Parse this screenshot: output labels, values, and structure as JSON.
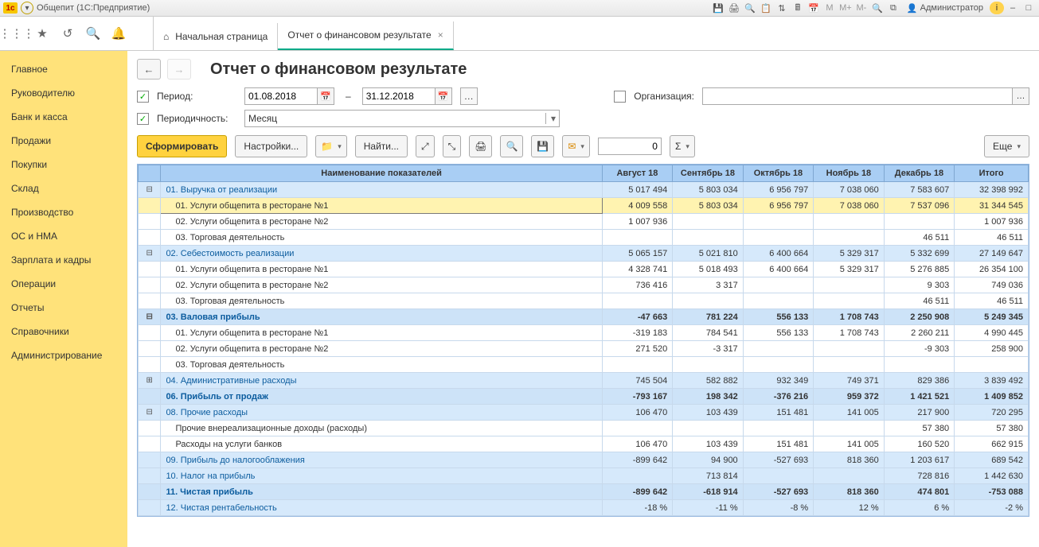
{
  "window": {
    "title": "Общепит  (1С:Предприятие)",
    "user": "Администратор"
  },
  "tabs": {
    "home": "Начальная страница",
    "report": "Отчет о финансовом результате"
  },
  "sidebar": {
    "items": [
      "Главное",
      "Руководителю",
      "Банк и касса",
      "Продажи",
      "Покупки",
      "Склад",
      "Производство",
      "ОС и НМА",
      "Зарплата и кадры",
      "Операции",
      "Отчеты",
      "Справочники",
      "Администрирование"
    ]
  },
  "page": {
    "title": "Отчет о финансовом результате"
  },
  "filters": {
    "period_label": "Период:",
    "date_from": "01.08.2018",
    "date_to": "31.12.2018",
    "org_label": "Организация:",
    "org_value": "",
    "periodicity_label": "Периодичность:",
    "periodicity_value": "Месяц"
  },
  "toolbar": {
    "generate": "Сформировать",
    "settings": "Настройки...",
    "find": "Найти...",
    "number_value": "0",
    "more": "Еще"
  },
  "table": {
    "headers": {
      "name": "Наименование показателей",
      "months": [
        "Август 18",
        "Сентябрь 18",
        "Октябрь 18",
        "Ноябрь 18",
        "Декабрь 18"
      ],
      "total": "Итого"
    },
    "rows": [
      {
        "lvl": 0,
        "tg": "-",
        "link": true,
        "name": "01. Выручка от реализации",
        "v": [
          "5 017 494",
          "5 803 034",
          "6 956 797",
          "7 038 060",
          "7 583 607",
          "32 398 992"
        ]
      },
      {
        "lvl": 1,
        "hl": true,
        "name": "01. Услуги общепита в ресторане №1",
        "v": [
          "4 009 558",
          "5 803 034",
          "6 956 797",
          "7 038 060",
          "7 537 096",
          "31 344 545"
        ]
      },
      {
        "lvl": 1,
        "name": "02. Услуги общепита в ресторане №2",
        "v": [
          "1 007 936",
          "",
          "",
          "",
          "",
          "1 007 936"
        ]
      },
      {
        "lvl": 1,
        "name": "03. Торговая деятельность",
        "v": [
          "",
          "",
          "",
          "",
          "46 511",
          "46 511"
        ]
      },
      {
        "lvl": 0,
        "tg": "-",
        "link": true,
        "name": "02. Себестоимость реализации",
        "v": [
          "5 065 157",
          "5 021 810",
          "6 400 664",
          "5 329 317",
          "5 332 699",
          "27 149 647"
        ]
      },
      {
        "lvl": 1,
        "name": "01. Услуги общепита в ресторане №1",
        "v": [
          "4 328 741",
          "5 018 493",
          "6 400 664",
          "5 329 317",
          "5 276 885",
          "26 354 100"
        ]
      },
      {
        "lvl": 1,
        "name": "02. Услуги общепита в ресторане №2",
        "v": [
          "736 416",
          "3 317",
          "",
          "",
          "9 303",
          "749 036"
        ]
      },
      {
        "lvl": 1,
        "name": "03. Торговая деятельность",
        "v": [
          "",
          "",
          "",
          "",
          "46 511",
          "46 511"
        ]
      },
      {
        "lvl": 0,
        "tg": "-",
        "bold": true,
        "link": true,
        "name": "03. Валовая прибыль",
        "v": [
          "-47 663",
          "781 224",
          "556 133",
          "1 708 743",
          "2 250 908",
          "5 249 345"
        ]
      },
      {
        "lvl": 1,
        "name": "01. Услуги общепита в ресторане №1",
        "v": [
          "-319 183",
          "784 541",
          "556 133",
          "1 708 743",
          "2 260 211",
          "4 990 445"
        ]
      },
      {
        "lvl": 1,
        "name": "02. Услуги общепита в ресторане №2",
        "v": [
          "271 520",
          "-3 317",
          "",
          "",
          "-9 303",
          "258 900"
        ]
      },
      {
        "lvl": 1,
        "name": "03. Торговая деятельность",
        "v": [
          "",
          "",
          "",
          "",
          "",
          ""
        ]
      },
      {
        "lvl": 0,
        "tg": "+",
        "link": true,
        "name": "04. Административные расходы",
        "v": [
          "745 504",
          "582 882",
          "932 349",
          "749 371",
          "829 386",
          "3 839 492"
        ]
      },
      {
        "lvl": 0,
        "bold": true,
        "link": true,
        "name": "06. Прибыль от продаж",
        "v": [
          "-793 167",
          "198 342",
          "-376 216",
          "959 372",
          "1 421 521",
          "1 409 852"
        ]
      },
      {
        "lvl": 0,
        "tg": "-",
        "link": true,
        "name": "08. Прочие расходы",
        "v": [
          "106 470",
          "103 439",
          "151 481",
          "141 005",
          "217 900",
          "720 295"
        ]
      },
      {
        "lvl": 1,
        "name": "Прочие внереализационные доходы (расходы)",
        "v": [
          "",
          "",
          "",
          "",
          "57 380",
          "57 380"
        ]
      },
      {
        "lvl": 1,
        "name": "Расходы на услуги банков",
        "v": [
          "106 470",
          "103 439",
          "151 481",
          "141 005",
          "160 520",
          "662 915"
        ]
      },
      {
        "lvl": 0,
        "link": true,
        "name": "09. Прибыль до налогооблажения",
        "v": [
          "-899 642",
          "94 900",
          "-527 693",
          "818 360",
          "1 203 617",
          "689 542"
        ]
      },
      {
        "lvl": 0,
        "link": true,
        "name": "10. Налог на прибыль",
        "v": [
          "",
          "713 814",
          "",
          "",
          "728 816",
          "1 442 630"
        ]
      },
      {
        "lvl": 0,
        "bold": true,
        "link": true,
        "name": "11. Чистая прибыль",
        "v": [
          "-899 642",
          "-618 914",
          "-527 693",
          "818 360",
          "474 801",
          "-753 088"
        ]
      },
      {
        "lvl": 0,
        "link": true,
        "name": "12. Чистая рентабельность",
        "v": [
          "-18  %",
          "-11  %",
          "-8  %",
          "12  %",
          "6  %",
          "-2  %"
        ]
      }
    ]
  }
}
